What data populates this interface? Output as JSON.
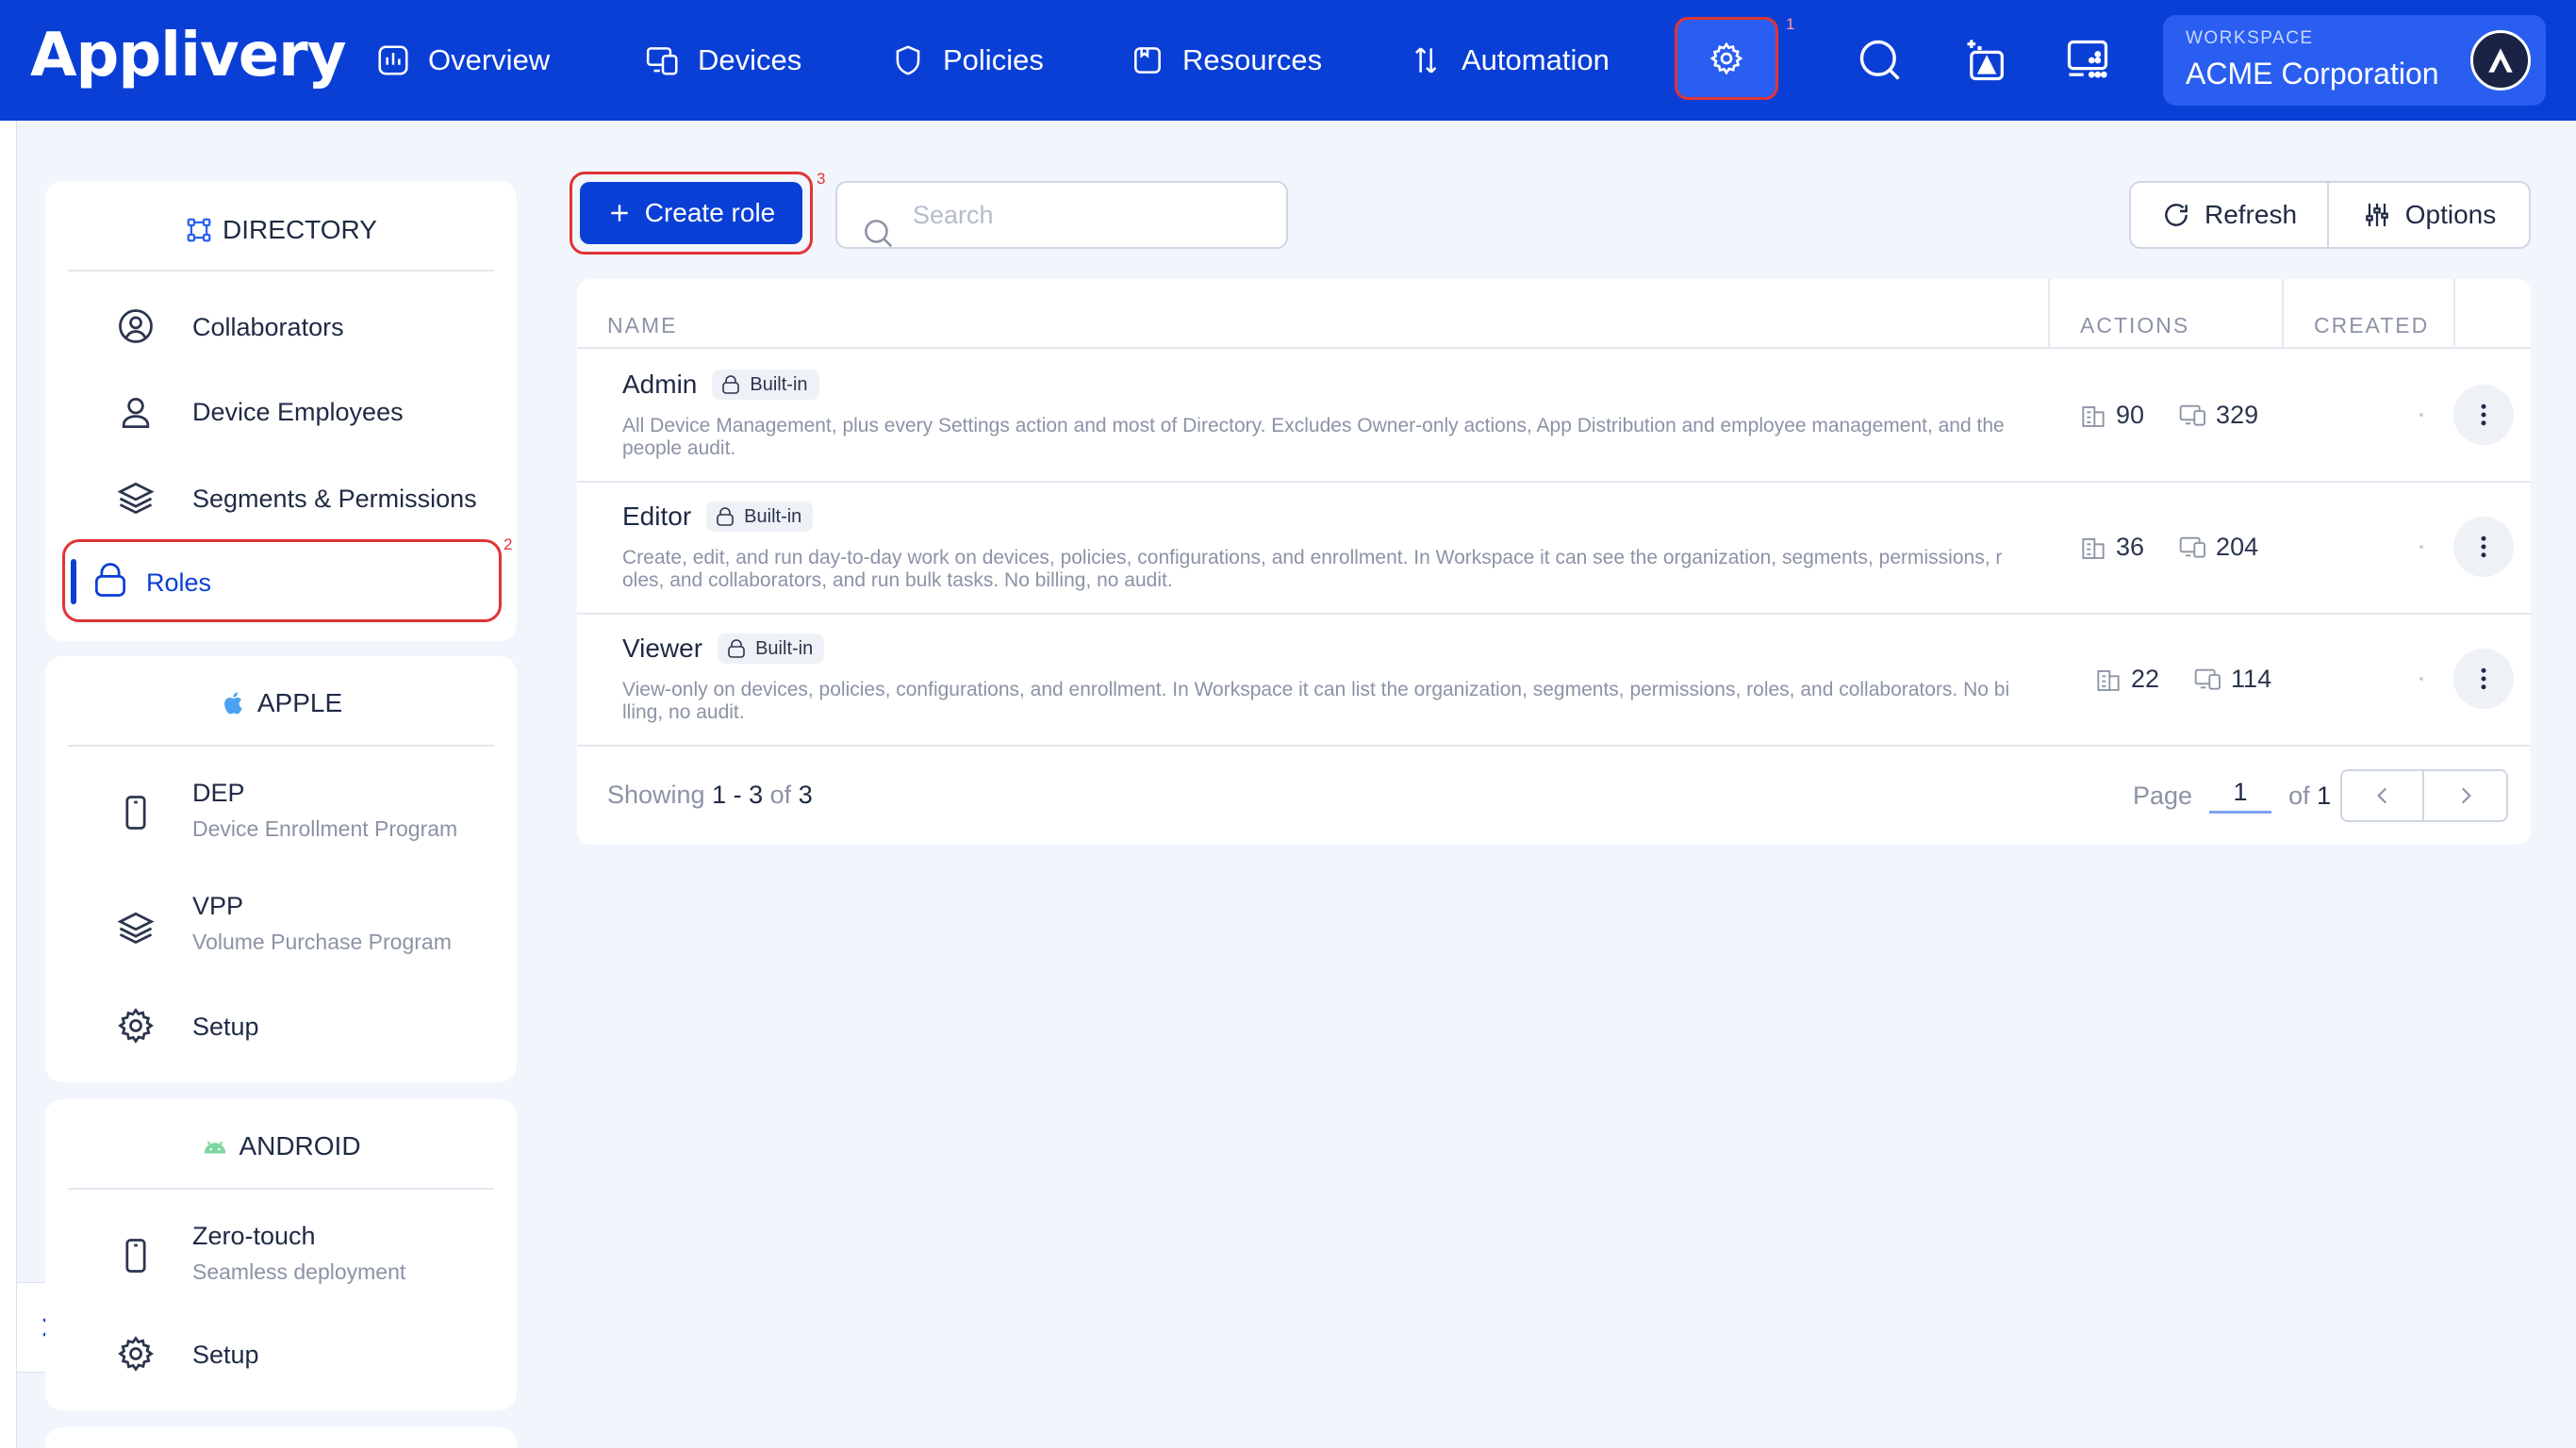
{
  "app": {
    "logo": "Applivery"
  },
  "nav": {
    "items": [
      {
        "label": "Overview",
        "icon": "chart-icon"
      },
      {
        "label": "Devices",
        "icon": "devices-icon"
      },
      {
        "label": "Policies",
        "icon": "shield-icon"
      },
      {
        "label": "Resources",
        "icon": "folder-icon"
      },
      {
        "label": "Automation",
        "icon": "automation-icon"
      }
    ],
    "settings_annotation": "1"
  },
  "workspace": {
    "label": "WORKSPACE",
    "name": "ACME Corporation"
  },
  "sidebar": {
    "directory": {
      "title": "DIRECTORY",
      "items": [
        {
          "label": "Collaborators",
          "icon": "user-circle-icon"
        },
        {
          "label": "Device Employees",
          "icon": "user-icon"
        },
        {
          "label": "Segments & Permissions",
          "icon": "layers-icon"
        },
        {
          "label": "Roles",
          "icon": "lock-icon",
          "active": true
        }
      ],
      "roles_annotation": "2"
    },
    "apple": {
      "title": "APPLE",
      "items": [
        {
          "label": "DEP",
          "sub": "Device Enrollment Program",
          "icon": "phone-icon"
        },
        {
          "label": "VPP",
          "sub": "Volume Purchase Program",
          "icon": "layers-icon"
        },
        {
          "label": "Setup",
          "icon": "gear-icon"
        }
      ]
    },
    "android": {
      "title": "ANDROID",
      "items": [
        {
          "label": "Zero-touch",
          "sub": "Seamless deployment",
          "icon": "phone-icon"
        },
        {
          "label": "Setup",
          "icon": "gear-icon"
        }
      ]
    }
  },
  "toolbar": {
    "create_label": "Create role",
    "create_annotation": "3",
    "search_placeholder": "Search",
    "refresh_label": "Refresh",
    "options_label": "Options"
  },
  "table": {
    "columns": [
      "NAME",
      "ACTIONS",
      "CREATED"
    ],
    "rows": [
      {
        "name": "Admin",
        "badge": "Built-in",
        "description": "All Device Management, plus every Settings action and most of Directory. Excludes Owner-only actions, App Distribution and employee management, and the people audit.",
        "count_a": "90",
        "count_b": "329"
      },
      {
        "name": "Editor",
        "badge": "Built-in",
        "description": "Create, edit, and run day-to-day work on devices, policies, configurations, and enrollment. In Workspace it can see the organization, segments, permissions, roles, and collaborators, and run bulk tasks. No billing, no audit.",
        "count_a": "36",
        "count_b": "204"
      },
      {
        "name": "Viewer",
        "badge": "Built-in",
        "description": "View-only on devices, policies, configurations, and enrollment. In Workspace it can list the organization, segments, permissions, roles, and collaborators. No billing, no audit.",
        "count_a": "22",
        "count_b": "114"
      }
    ],
    "footer": {
      "showing": "Showing",
      "from": "1",
      "dash": " - ",
      "to": "3",
      "of": " of ",
      "total": "3",
      "page_label": "Page",
      "page": "1",
      "of_label": "of",
      "pages": "1"
    }
  },
  "colors": {
    "brand": "#0a3fd6",
    "annotation": "#e03434",
    "background": "#f1f5fc"
  }
}
